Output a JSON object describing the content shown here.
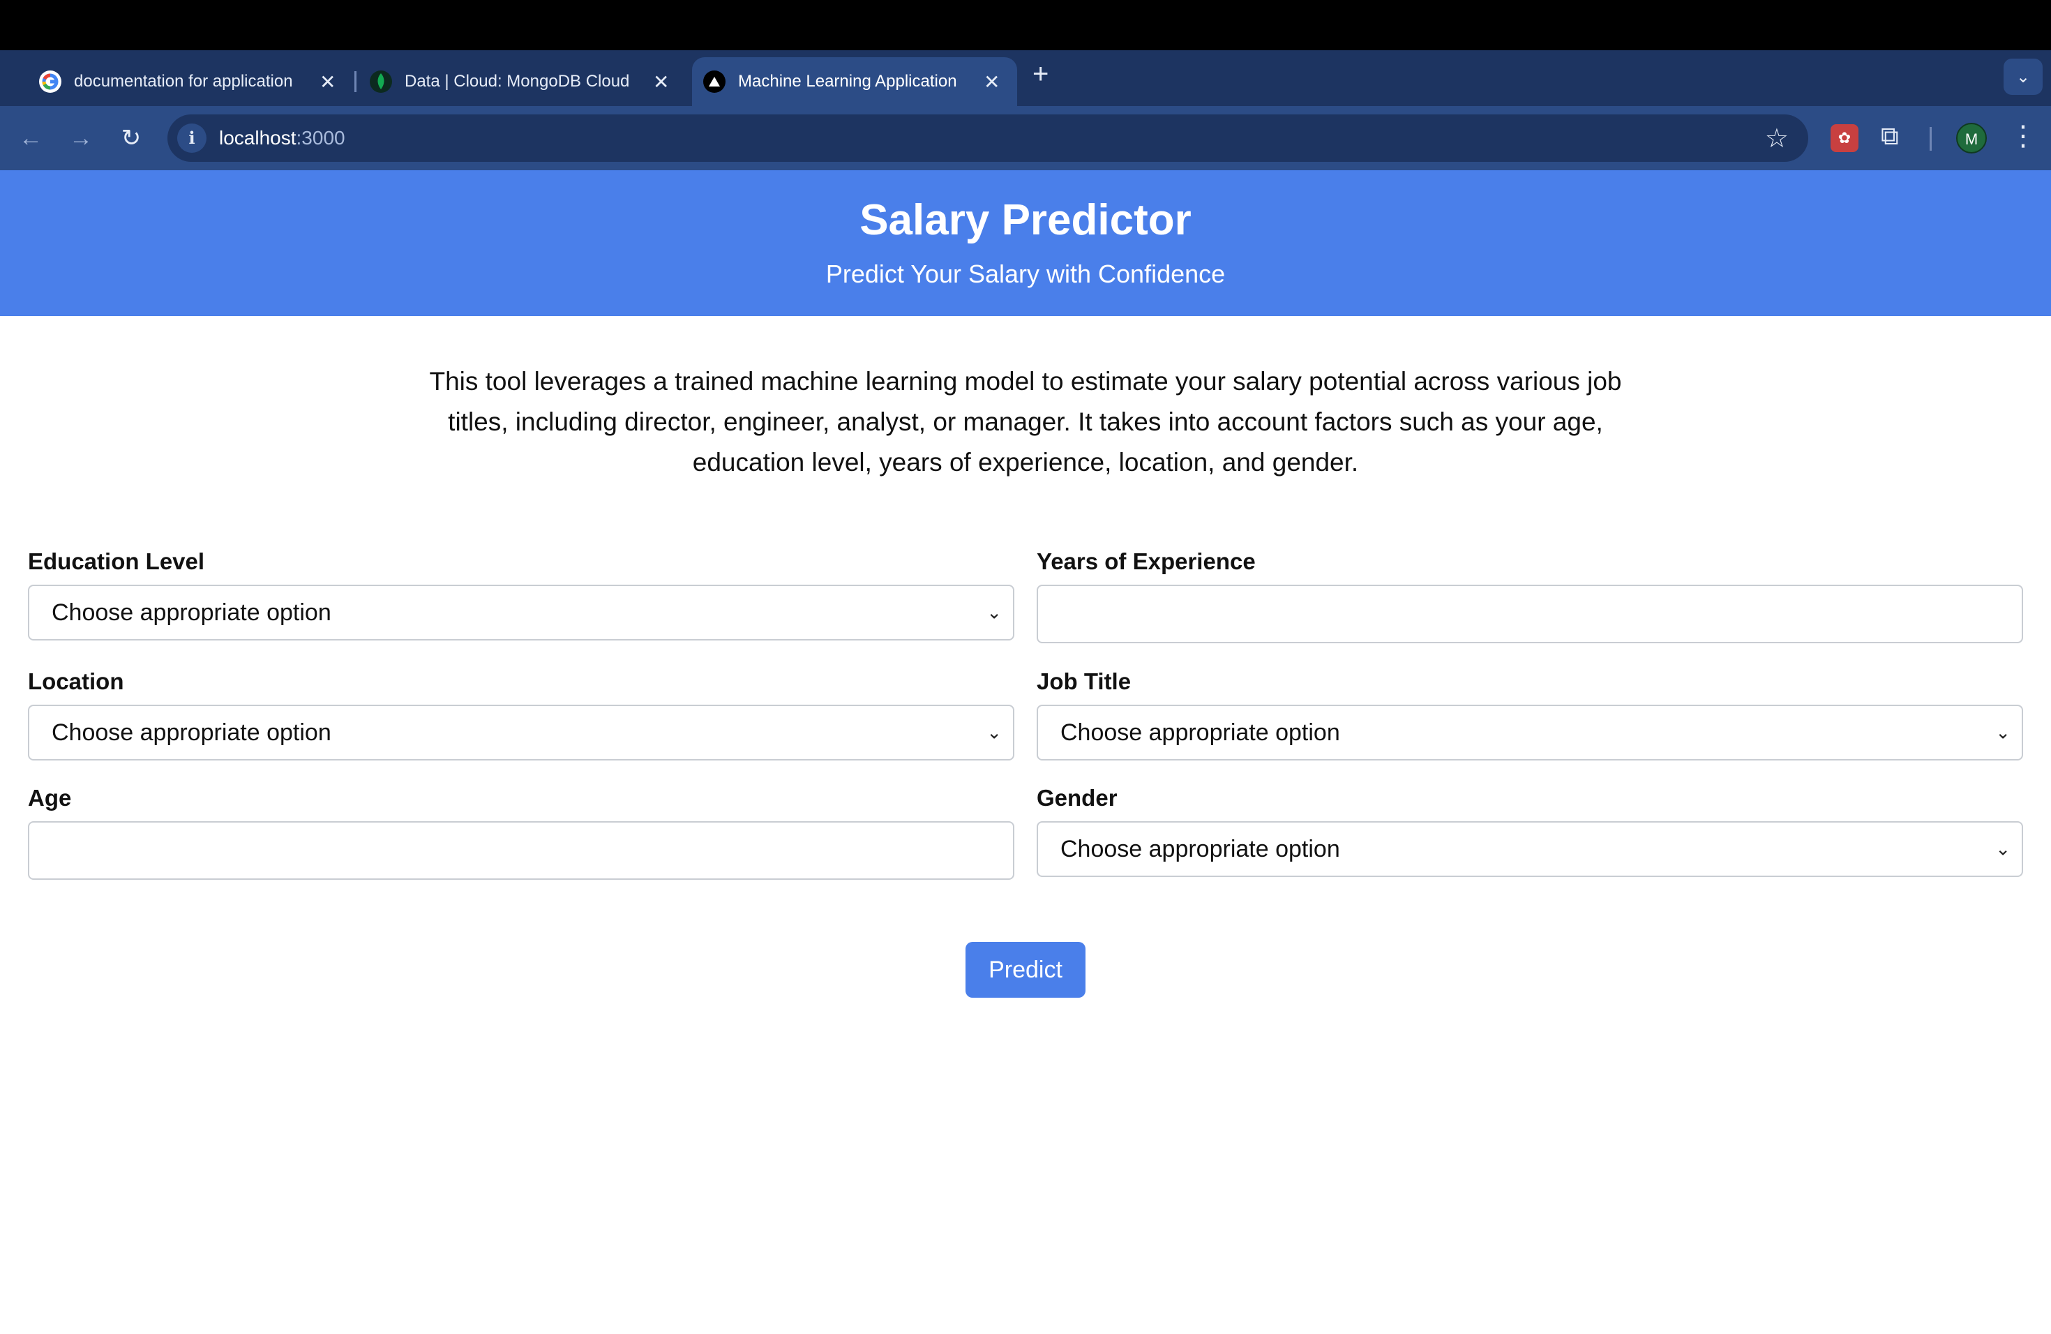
{
  "browser": {
    "tabs": [
      {
        "title": "documentation for application",
        "favicon": "google-g-icon"
      },
      {
        "title": "Data | Cloud: MongoDB Cloud",
        "favicon": "mongodb-leaf-icon"
      },
      {
        "title": "Machine Learning Application",
        "favicon": "triangle-logo-icon",
        "active": true
      }
    ],
    "new_tab": "+",
    "close_glyph": "✕",
    "url_host": "localhost",
    "url_port": ":3000",
    "avatar_initial": "M"
  },
  "hero": {
    "title": "Salary Predictor",
    "subtitle": "Predict Your Salary with Confidence"
  },
  "description": "This tool leverages a trained machine learning model to estimate your salary potential across various job titles, including director, engineer, analyst, or manager. It takes into account factors such as your age, education level, years of experience, location, and gender.",
  "form": {
    "education": {
      "label": "Education Level",
      "value": "Choose appropriate option"
    },
    "experience": {
      "label": "Years of Experience",
      "value": ""
    },
    "location": {
      "label": "Location",
      "value": "Choose appropriate option"
    },
    "job_title": {
      "label": "Job Title",
      "value": "Choose appropriate option"
    },
    "age": {
      "label": "Age",
      "value": ""
    },
    "gender": {
      "label": "Gender",
      "value": "Choose appropriate option"
    },
    "submit": "Predict"
  },
  "colors": {
    "accent": "#4a7fea",
    "tabstrip": "#1d3461",
    "toolbar": "#2c4c86"
  }
}
